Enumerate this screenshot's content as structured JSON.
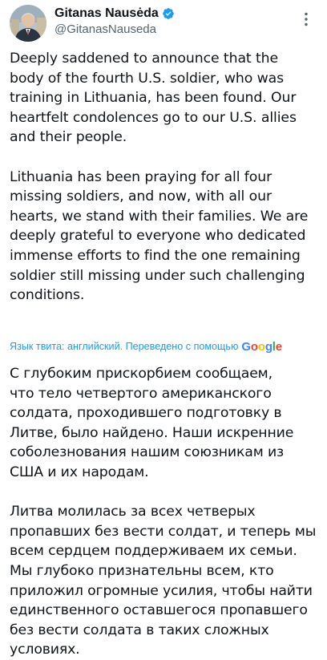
{
  "tweet": {
    "author": {
      "name": "Gitanas Nausėda",
      "handle": "@GitanasNauseda",
      "verified": true
    },
    "more_icon": "more-vertical-icon",
    "text": "Deeply saddened to announce that the\nbody of the fourth U.S. soldier, who was\ntraining in Lithuania, has been found. Our\nheartfelt condolences go to our U.S. allies\nand their people.\n\nLithuania has been praying for all four\nmissing soldiers, and now, with all our\nhearts, we stand with their families. We are\ndeeply grateful to everyone who dedicated\nimmense efforts to find the one remaining\nsoldier still missing under such challenging\nconditions.",
    "translation": {
      "note": "Язык твита: английский. Переведено с помощью",
      "provider": "Google",
      "text": "С глубоким прискорбием сообщаем,\nчто тело четвертого американского\nсолдата, проходившего подготовку в\nЛитве, было найдено. Наши искренние\nсоболезнования нашим союзникам из\nСША и их народам.\n\nЛитва молилась за всех четверых\nпропавших без вести солдат, и теперь мы\nвсем сердцем поддерживаем их семьи.\nМы глубоко признательны всем, кто\nприложил огромные усилия, чтобы найти\nединственного оставшегося пропавшего\nбез вести солдата в таких сложных\nусловиях."
    }
  },
  "colors": {
    "text": "#0f1419",
    "secondary_text": "#536471",
    "link": "#1d9bf0",
    "verified": "#1d9bf0"
  }
}
